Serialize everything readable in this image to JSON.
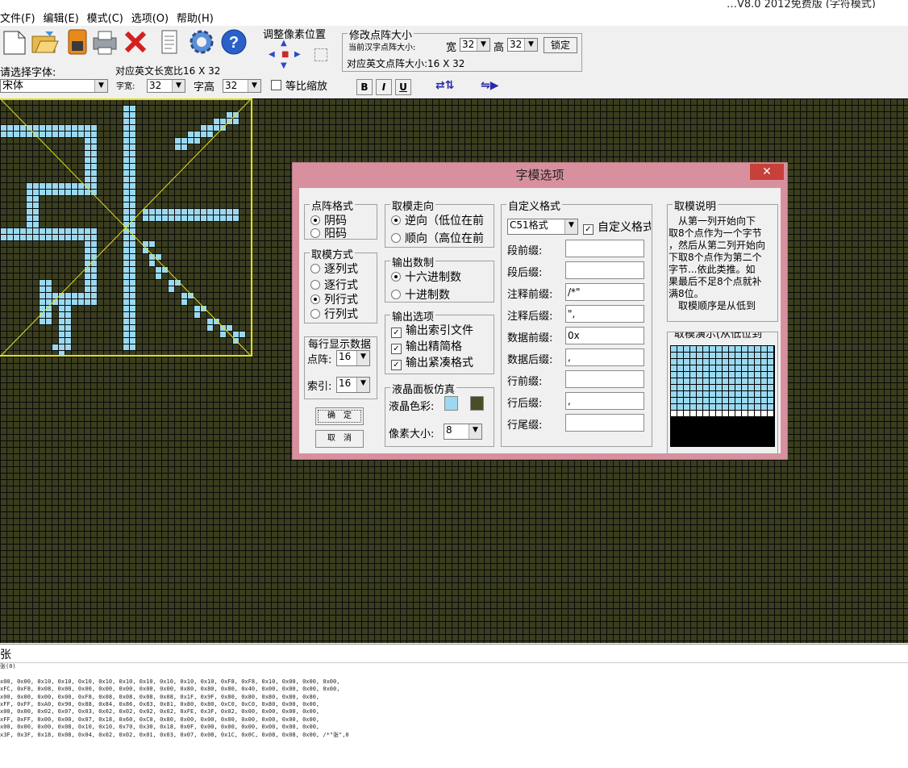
{
  "window": {
    "title": "…V8.0 2012免费版 (字符模式)"
  },
  "menu": [
    "文件(F)",
    "编辑(E)",
    "模式(C)",
    "选项(O)",
    "帮助(H)"
  ],
  "toolbar": {
    "adjust_pixel_label": "调整像素位置",
    "modify_size_label": "修改点阵大小",
    "current_size_label": "当前汉字点阵大小:",
    "width_label": "宽",
    "width_value": "32",
    "height_label": "高",
    "height_value": "32",
    "lock_label": "锁定",
    "english_size_label": "对应英文点阵大小:16 X 32",
    "select_font_label": "请选择字体:",
    "english_long_label": "对应英文长宽比16 X 32",
    "font_value": "宋体",
    "char_width_label": "字宽:",
    "char_width_value": "32",
    "char_height_label": "字高",
    "char_height_value": "32",
    "proportional_label": "等比缩放",
    "bold_label": "B",
    "italic_label": "I",
    "underline_label": "U"
  },
  "icons": [
    "new-file-icon",
    "open-folder-icon",
    "save-icon",
    "print-icon",
    "delete-icon",
    "notes-icon",
    "gear-icon",
    "help-icon"
  ],
  "colors": {
    "lcd_pixel": "#9ad9f0",
    "lcd_background": "#3a3d1e",
    "grid": "#0a0a0a",
    "dialog_frame": "#d8909f",
    "guide": "#e0e020"
  },
  "dialog": {
    "title": "字模选项",
    "close": "✕",
    "matrix_format": {
      "title": "点阵格式",
      "options": [
        "阴码",
        "阳码"
      ],
      "selected": 0
    },
    "scan_mode": {
      "title": "取模方式",
      "options": [
        "逐列式",
        "逐行式",
        "列行式",
        "行列式"
      ],
      "selected": 2
    },
    "per_line": {
      "title": "每行显示数据",
      "matrix_label": "点阵:",
      "matrix_value": "16",
      "index_label": "索引:",
      "index_value": "16"
    },
    "ok_label": "确　定",
    "cancel_label": "取　消",
    "direction": {
      "title": "取模走向",
      "options": [
        "逆向（低位在前",
        "顺向（高位在前"
      ],
      "selected": 0
    },
    "number_base": {
      "title": "输出数制",
      "options": [
        "十六进制数",
        "十进制数"
      ],
      "selected": 0
    },
    "output_options": {
      "title": "输出选项",
      "options": [
        "输出索引文件",
        "输出精简格",
        "输出紧凑格式"
      ]
    },
    "lcd_sim": {
      "title": "液晶面板仿真",
      "color_label": "液晶色彩:",
      "pixel_size_label": "像素大小:",
      "pixel_size_value": "8"
    },
    "custom_format": {
      "title": "自定义格式",
      "format_value": "C51格式",
      "custom_check_label": "自定义格式",
      "fields": [
        {
          "label": "段前缀:",
          "value": ""
        },
        {
          "label": "段后缀:",
          "value": ""
        },
        {
          "label": "注释前缀:",
          "value": "/*\""
        },
        {
          "label": "注释后缀:",
          "value": "\","
        },
        {
          "label": "数据前缀:",
          "value": "0x"
        },
        {
          "label": "数据后缀:",
          "value": ","
        },
        {
          "label": "行前缀:",
          "value": ""
        },
        {
          "label": "行后缀:",
          "value": ","
        },
        {
          "label": "行尾缀:",
          "value": ""
        }
      ]
    },
    "description": {
      "title": "取模说明",
      "lines": [
        "　从第一列开始向下",
        "取8个点作为一个字节",
        "，然后从第二列开始向",
        "下取8个点作为第二个",
        "字节...依此类推。如",
        "果最后不足8个点就补",
        "满8位。",
        "　取模顺序是从低到"
      ]
    },
    "demo": {
      "title": "取模演示(从低位到"
    }
  },
  "bottom": {
    "input_char": "张",
    "output_lines": [
      "张(0)",
      "",
      "x00, 0x00, 0x10, 0x10, 0x10, 0x10, 0x10, 0x10, 0x10, 0x10, 0x10, 0xF8, 0xF8, 0x10, 0x00, 0x00, 0x00,",
      "xFC, 0xF8, 0x08, 0x00, 0x00, 0x00, 0x00, 0x00, 0x00, 0x80, 0x80, 0x80, 0x40, 0x00, 0x00, 0x00, 0x00,",
      "x00, 0x00, 0x00, 0x00, 0xF8, 0x08, 0x08, 0x08, 0x08, 0x1F, 0x9F, 0x80, 0x80, 0x80, 0x80, 0x80,",
      "xFF, 0xFF, 0xA0, 0x90, 0x88, 0x84, 0x86, 0x83, 0x81, 0x80, 0x80, 0xC0, 0xC0, 0x80, 0x00, 0x00,",
      "x00, 0x00, 0x02, 0x07, 0x03, 0x02, 0x02, 0x02, 0x02, 0xFE, 0x3F, 0x02, 0x00, 0x00, 0x00, 0x00,",
      "xFF, 0xFF, 0x00, 0x00, 0x07, 0x18, 0x60, 0xC0, 0x80, 0x00, 0x00, 0x00, 0x00, 0x00, 0x00, 0x00,",
      "x00, 0x00, 0x00, 0x08, 0x10, 0x10, 0x70, 0x30, 0x18, 0x0F, 0x00, 0x00, 0x00, 0x00, 0x00, 0x00,",
      "x3F, 0x3F, 0x18, 0x08, 0x04, 0x02, 0x02, 0x01, 0x03, 0x07, 0x08, 0x1C, 0x0C, 0x08, 0x08, 0x00, /*\"张\",0"
    ]
  }
}
